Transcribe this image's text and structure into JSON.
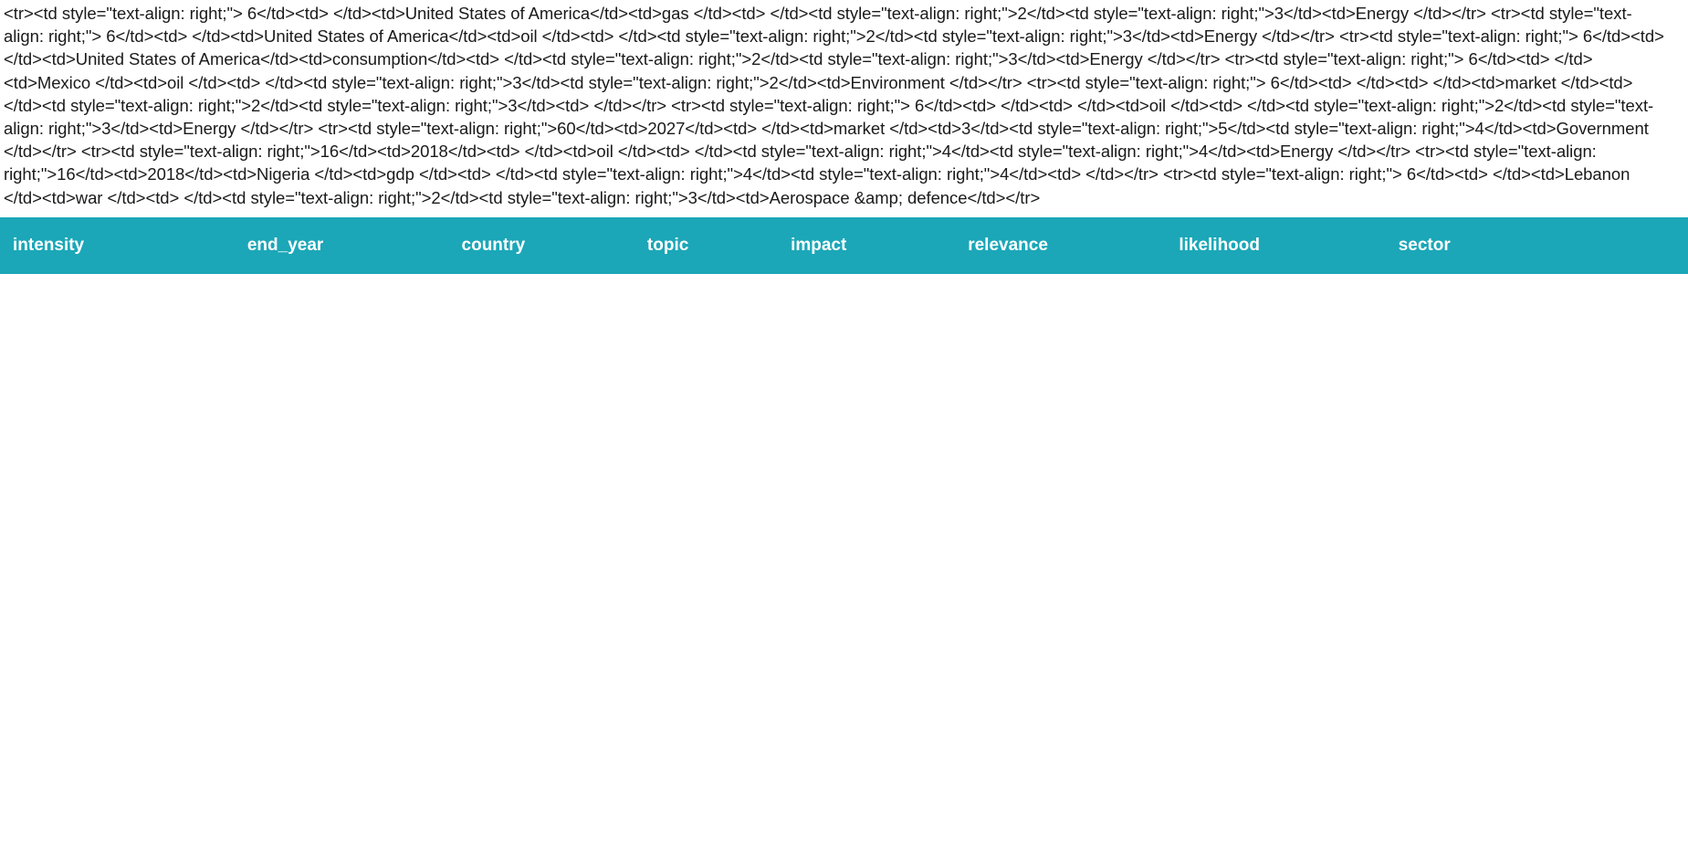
{
  "raw_markup_text": "<tr><td style=\"text-align: right;\"> 6</td><td> </td><td>United States of America</td><td>gas </td><td> </td><td style=\"text-align: right;\">2</td><td style=\"text-align: right;\">3</td><td>Energy </td></tr> <tr><td style=\"text-align: right;\"> 6</td><td> </td><td>United States of America</td><td>oil </td><td> </td><td style=\"text-align: right;\">2</td><td style=\"text-align: right;\">3</td><td>Energy </td></tr> <tr><td style=\"text-align: right;\"> 6</td><td> </td><td>United States of America</td><td>consumption</td><td> </td><td style=\"text-align: right;\">2</td><td style=\"text-align: right;\">3</td><td>Energy </td></tr> <tr><td style=\"text-align: right;\"> 6</td><td> </td><td>Mexico </td><td>oil </td><td> </td><td style=\"text-align: right;\">3</td><td style=\"text-align: right;\">2</td><td>Environment </td></tr> <tr><td style=\"text-align: right;\"> 6</td><td> </td><td> </td><td>market </td><td> </td><td style=\"text-align: right;\">2</td><td style=\"text-align: right;\">3</td><td> </td></tr> <tr><td style=\"text-align: right;\"> 6</td><td> </td><td> </td><td>oil </td><td> </td><td style=\"text-align: right;\">2</td><td style=\"text-align: right;\">3</td><td>Energy </td></tr> <tr><td style=\"text-align: right;\">60</td><td>2027</td><td> </td><td>market </td><td>3</td><td style=\"text-align: right;\">5</td><td style=\"text-align: right;\">4</td><td>Government </td></tr> <tr><td style=\"text-align: right;\">16</td><td>2018</td><td> </td><td>oil </td><td> </td><td style=\"text-align: right;\">4</td><td style=\"text-align: right;\">4</td><td>Energy </td></tr> <tr><td style=\"text-align: right;\">16</td><td>2018</td><td>Nigeria </td><td>gdp </td><td> </td><td style=\"text-align: right;\">4</td><td style=\"text-align: right;\">4</td><td> </td></tr> <tr><td style=\"text-align: right;\"> 6</td><td> </td><td>Lebanon </td><td>war </td><td> </td><td style=\"text-align: right;\">2</td><td style=\"text-align: right;\">3</td><td>Aerospace &amp; defence</td></tr>",
  "table": {
    "header_background": "#1ba7b8",
    "header_text_color": "#ffffff",
    "columns": [
      {
        "key": "intensity",
        "label": "intensity"
      },
      {
        "key": "end_year",
        "label": "end_year"
      },
      {
        "key": "country",
        "label": "country"
      },
      {
        "key": "topic",
        "label": "topic"
      },
      {
        "key": "impact",
        "label": "impact"
      },
      {
        "key": "relevance",
        "label": "relevance"
      },
      {
        "key": "likelihood",
        "label": "likelihood"
      },
      {
        "key": "sector",
        "label": "sector"
      }
    ],
    "rows": []
  }
}
